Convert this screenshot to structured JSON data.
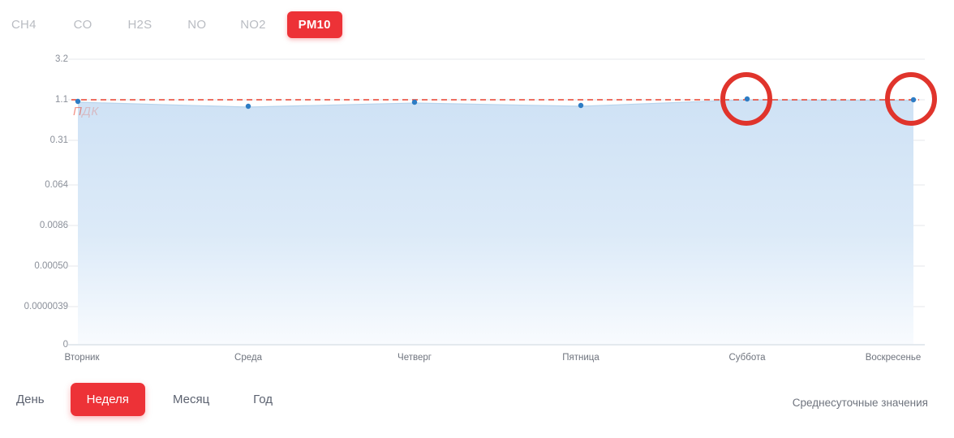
{
  "pollutant_tabs": {
    "items": [
      {
        "label": "CH4",
        "active": false
      },
      {
        "label": "CO",
        "active": false
      },
      {
        "label": "H2S",
        "active": false
      },
      {
        "label": "NO",
        "active": false
      },
      {
        "label": "NO2",
        "active": false
      },
      {
        "label": "PM10",
        "active": true
      }
    ]
  },
  "period_controls": {
    "items": [
      {
        "label": "День",
        "active": false
      },
      {
        "label": "Неделя",
        "active": true
      },
      {
        "label": "Месяц",
        "active": false
      },
      {
        "label": "Год",
        "active": false
      }
    ]
  },
  "avg_note": "Среднесуточные значения",
  "colors": {
    "accent_red": "#ed3237",
    "limit_line": "#e8412e",
    "point": "#2e7cc4",
    "area_top": "#d5e6f7",
    "area_bottom": "#f7fbfe",
    "gridline": "#e3e6ea",
    "tab_inactive": "#b9bcc2"
  },
  "chart_data": {
    "type": "area",
    "title": "",
    "xlabel": "",
    "ylabel": "",
    "grid": true,
    "legend": "none",
    "categories": [
      "Вторник",
      "Среда",
      "Четверг",
      "Пятница",
      "Суббота",
      "Воскресенье"
    ],
    "ytick_labels": [
      "3.2",
      "1.1",
      "0.31",
      "0.064",
      "0.0086",
      "0.00050",
      "0.0000039",
      "0"
    ],
    "ytick_values": [
      3.2,
      1.1,
      0.31,
      0.064,
      0.0086,
      0.0005,
      3.9e-06,
      0
    ],
    "ylim": [
      0,
      3.2
    ],
    "series": [
      {
        "name": "PM10",
        "values": [
          1.1,
          1.05,
          1.09,
          1.06,
          1.09,
          1.1
        ]
      }
    ],
    "limit_line": {
      "label": "ПДК",
      "value": 1.1,
      "style": "dashed",
      "color": "#e8412e"
    },
    "annotations": [
      {
        "type": "circle-highlight",
        "category": "Суббота",
        "color": "#e0342c"
      },
      {
        "type": "circle-highlight",
        "category": "Воскресенье",
        "color": "#e0342c"
      }
    ]
  }
}
